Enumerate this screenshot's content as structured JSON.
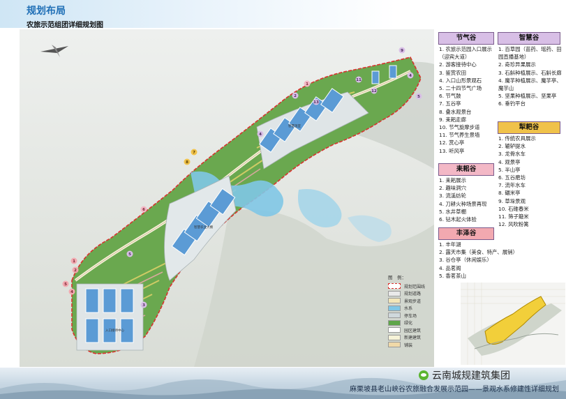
{
  "header": {
    "title": "规划布局",
    "subtitle": "农旅示范组团详细规划图"
  },
  "sections": {
    "jieqigu": {
      "name": "节气谷",
      "color": "#d8bfe6",
      "items": [
        "1. 农旅示范园入口展示（迎宾大道）",
        "2. 游客接待中心",
        "3. 鉴赏农田",
        "4. 入口山形景观石",
        "5. 二十四节气广场",
        "6. 节气鼓",
        "7. 五谷亭",
        "8. 叠水观景台",
        "9. 耒耜走廊",
        "10. 节气旋摩步道",
        "11. 节气养生景墙",
        "12. 赏心亭",
        "13. 听风亭"
      ]
    },
    "leisigu": {
      "name": "耒耜谷",
      "color": "#f3b8c6",
      "items": [
        "1. 耒耜展示",
        "2. 趣味洞穴",
        "3. 流溪纺轮",
        "4. 刀耕火种场景再现",
        "5. 水井草棚",
        "6. 钻木起火体验"
      ]
    },
    "fengzegu": {
      "name": "丰泽谷",
      "color": "#f2a9b0",
      "items": [
        "1. 丰年湖",
        "2. 露天市集（美食、特产、展销）",
        "3. 谷仓亭（休闲娱乐）",
        "4. 品茗阁",
        "5. 香茗茶山"
      ]
    },
    "zhihuigu": {
      "name": "智慧谷",
      "color": "#d8bfe6",
      "items": [
        "1. 百草园（苗药、瑶药、田园直播基地）",
        "2. 奇珍异果展示",
        "3. 石斛种植展示、石斛长廊",
        "4. 魔芋种植展示、魔芋亭、魔芋山",
        "5. 坚果种植展示、坚果亭",
        "6. 垂钓平台"
      ]
    },
    "lijiagu": {
      "name": "犁耙谷",
      "color": "#f0c24a",
      "items": [
        "1. 传统农具展示",
        "2. 辘轳提水",
        "3. 龙骨水车",
        "4. 观景亭",
        "5. 半山亭",
        "6. 五谷磨坊",
        "7. 流年水车",
        "8. 碾米亭",
        "9. 草垛景观",
        "10. 石碓春米",
        "11. 筛子簸米",
        "12. 风吹粉篱"
      ]
    }
  },
  "legend": {
    "title": "图　例：",
    "items": [
      {
        "label": "规划范围线",
        "color": "#d9322e"
      },
      {
        "label": "规划道路",
        "color": "#e9e9e9"
      },
      {
        "label": "景观步道",
        "color": "#f2e6b8"
      },
      {
        "label": "水系",
        "color": "#7fc7e6"
      },
      {
        "label": "停车场",
        "color": "#cfd8dc"
      },
      {
        "label": "绿化",
        "color": "#5ea64a"
      },
      {
        "label": "园区建筑",
        "color": "#ffffff"
      },
      {
        "label": "新建建筑",
        "color": "#f6f3d8"
      },
      {
        "label": "铺装",
        "color": "#f0d9a8"
      }
    ]
  },
  "map": {
    "building_label_1": "入口接待中心",
    "building_label_2": "智慧农业大棚",
    "building_label_3": "智慧温室"
  },
  "footer": {
    "wechat": "云南城规建筑集团",
    "caption": "麻栗坡县老山峡谷农旅融合发展示范园——景观水系修建性详细规划"
  }
}
